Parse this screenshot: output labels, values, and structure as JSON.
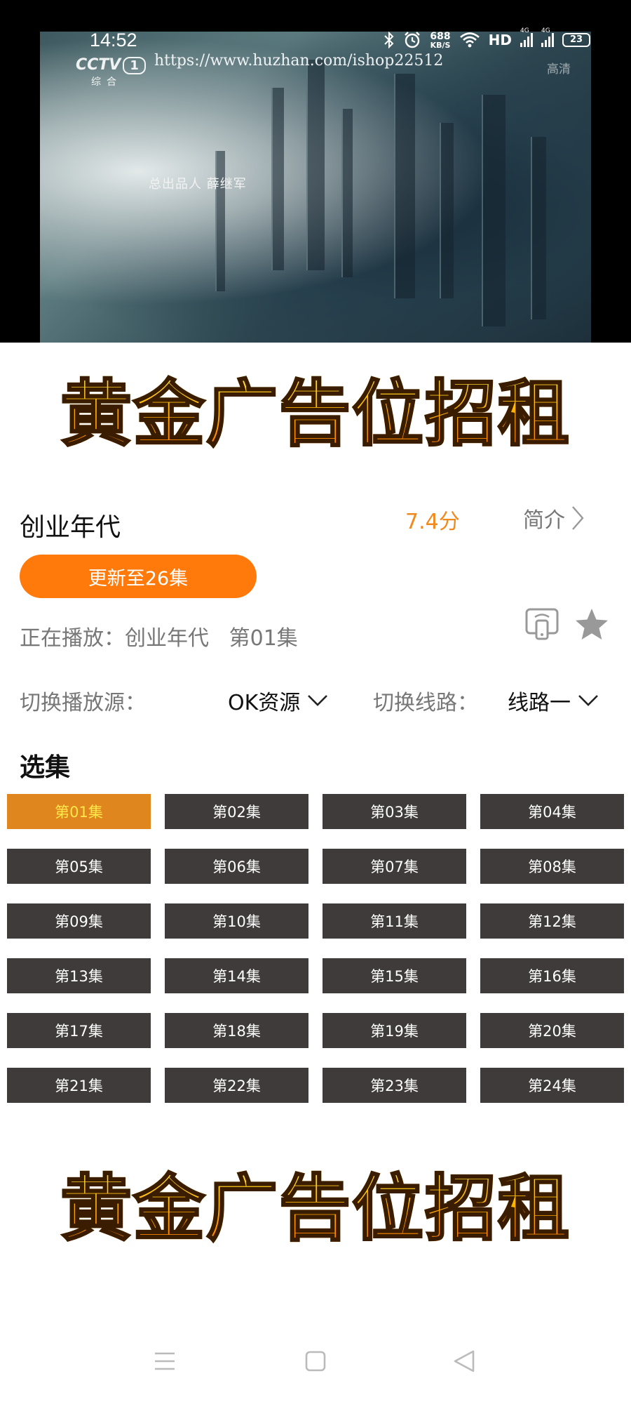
{
  "status_bar": {
    "time": "14:52",
    "net_speed_value": "688",
    "net_speed_unit": "KB/S",
    "hd_label": "HD",
    "signal1_tag": "4G",
    "signal2_tag": "4G",
    "battery": "23"
  },
  "video": {
    "channel_logo": "CCTV",
    "channel_number": "1",
    "channel_sub": "综合",
    "watermark_url": "https://www.huzhan.com/ishop22512",
    "corner_tag": "高清",
    "credit": "总出品人  薛继军"
  },
  "ads": {
    "top": "黄金广告位招租",
    "bottom": "黄金广告位招租"
  },
  "info": {
    "title": "创业年代",
    "score": "7.4分",
    "intro_label": "简介",
    "update_label": "更新至26集",
    "now_playing": "正在播放：创业年代   第01集"
  },
  "source": {
    "label": "切换播放源：",
    "value": "OK资源",
    "line_label": "切换线路：",
    "line_value": "线路一"
  },
  "episodes": {
    "title": "选集",
    "items": [
      "第01集",
      "第02集",
      "第03集",
      "第04集",
      "第05集",
      "第06集",
      "第07集",
      "第08集",
      "第09集",
      "第10集",
      "第11集",
      "第12集",
      "第13集",
      "第14集",
      "第15集",
      "第16集",
      "第17集",
      "第18集",
      "第19集",
      "第20集",
      "第21集",
      "第22集",
      "第23集",
      "第24集"
    ],
    "active_index": 0
  },
  "colors": {
    "accent": "#ff7a0a",
    "score": "#f08a1c",
    "episode_bg": "#3f3b3a",
    "episode_active_bg": "#e0861f",
    "episode_active_text": "#ffe94a"
  },
  "icons": {
    "intro_chevron": "chevron-right-icon",
    "cast": "cast-screen-icon",
    "favorite": "star-icon",
    "dropdown": "chevron-down-icon",
    "nav_menu": "menu-icon",
    "nav_home": "square-home-icon",
    "nav_back": "triangle-back-icon"
  }
}
